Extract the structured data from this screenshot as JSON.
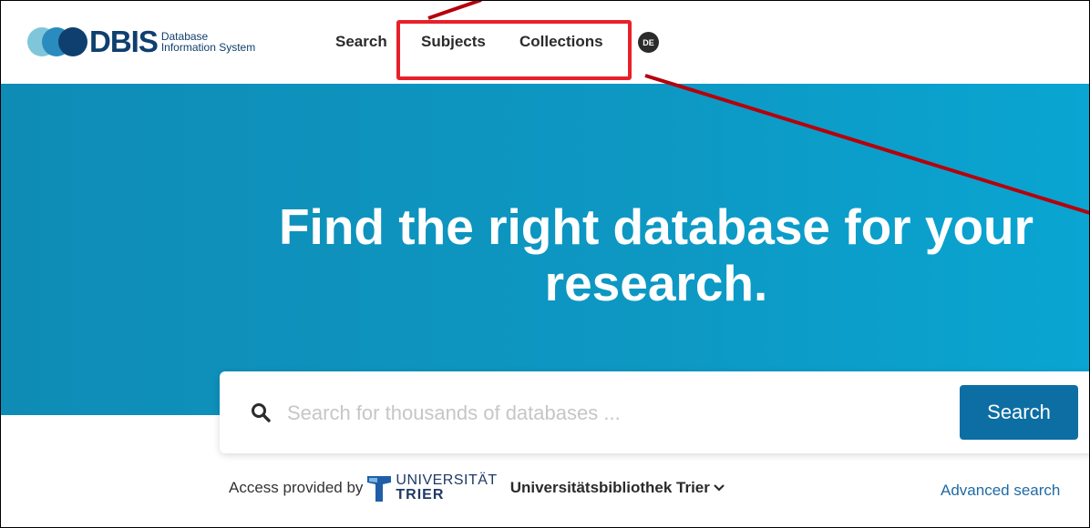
{
  "header": {
    "logo_text": "DBIS",
    "logo_sub_line1": "Database",
    "logo_sub_line2": "Information System",
    "nav": {
      "search": "Search",
      "subjects": "Subjects",
      "collections": "Collections"
    },
    "language": "DE"
  },
  "hero": {
    "title_line1": "Find the right database for your",
    "title_line2": "research."
  },
  "search": {
    "placeholder": "Search for thousands of databases ...",
    "button_label": "Search"
  },
  "access": {
    "label": "Access provided by",
    "uni_top": "UNIVERSITÄT",
    "uni_bottom": "TRIER",
    "institution": "Universitätsbibliothek Trier"
  },
  "advanced_search": "Advanced search",
  "colors": {
    "hero_blue": "#0d98c3",
    "button_blue": "#0d6ea3",
    "annotation_red": "#e8202a",
    "arrow_red": "#b5000b"
  }
}
